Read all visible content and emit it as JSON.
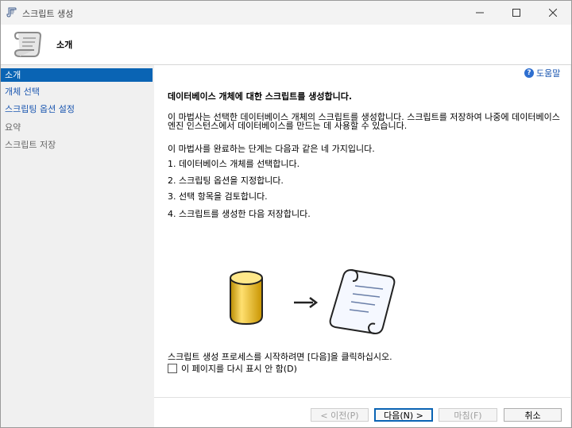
{
  "window": {
    "title": "스크립트 생성"
  },
  "header": {
    "title": "소개"
  },
  "sidebar": {
    "items": [
      {
        "label": "소개"
      },
      {
        "label": "개체 선택"
      },
      {
        "label": "스크립팅 옵션 설정"
      },
      {
        "label": "요약"
      },
      {
        "label": "스크립트 저장"
      }
    ]
  },
  "content": {
    "help_label": "도움말",
    "heading": "데이터베이스 개체에 대한 스크립트를 생성합니다.",
    "para": "이 마법사는 선택한 데이터베이스 개체의 스크립트를 생성합니다. 스크립트를 저장하여 나중에 데이터베이스 엔진 인스턴스에서 데이터베이스를 만드는 데 사용할 수 있습니다.",
    "intro2": "이 마법사를 완료하는 단계는 다음과 같은 네 가지입니다.",
    "steps": [
      "1. 데이터베이스 개체를 선택합니다.",
      "2. 스크립팅 옵션을 지정합니다.",
      "3. 선택 항목을 검토합니다.",
      "4. 스크립트를 생성한 다음 저장합니다."
    ],
    "instruction": "스크립트 생성 프로세스를 시작하려면 [다음]을 클릭하십시오.",
    "checkbox_label": "이 페이지를 다시 표시 안 함(D)",
    "checkbox_checked": false
  },
  "buttons": {
    "prev": "< 이전(P)",
    "next": "다음(N) >",
    "finish": "마침(F)",
    "cancel": "취소"
  },
  "colors": {
    "accent": "#0a64b4",
    "link": "#1a56b0",
    "cylinder": "#f0c020"
  }
}
